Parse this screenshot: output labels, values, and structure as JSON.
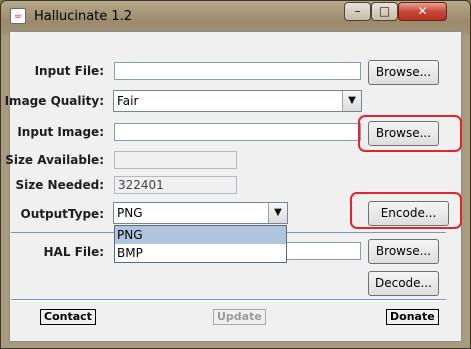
{
  "window": {
    "title": "Hallucinate 1.2",
    "app_icon": "java-cup-icon",
    "minimize": "–",
    "maximize": "□",
    "close": "✕"
  },
  "form": {
    "input_file": {
      "label": "Input File:",
      "value": "",
      "button": "Browse..."
    },
    "image_quality": {
      "label": "Image Quality:",
      "selected": "Fair",
      "arrow": "▼"
    },
    "input_image": {
      "label": "Input Image:",
      "value": "",
      "button": "Browse..."
    },
    "size_available": {
      "label": "Size Available:",
      "value": ""
    },
    "size_needed": {
      "label": "Size Needed:",
      "value": "322401"
    },
    "output_type": {
      "label": "OutputType:",
      "selected": "PNG",
      "arrow": "▼",
      "options": [
        "PNG",
        "BMP"
      ]
    },
    "encode_button": "Encode...",
    "hal_file": {
      "label": "HAL File:",
      "value": "",
      "button": "Browse..."
    },
    "decode_button": "Decode..."
  },
  "footer": {
    "contact": "Contact",
    "update": "Update",
    "donate": "Donate"
  },
  "colors": {
    "highlight": "#e0262a",
    "selected_option": "#b0c4de"
  }
}
